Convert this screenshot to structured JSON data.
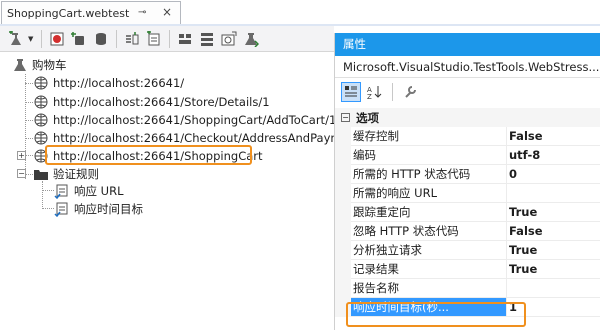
{
  "tab": {
    "title": "ShoppingCart.webtest",
    "pin_glyph": "⊸",
    "close_glyph": "×"
  },
  "toolbar": {
    "icons": [
      "add-request-icon",
      "record-icon",
      "insert-icon",
      "save-icon",
      "parameterize-icon",
      "extract-icon",
      "plugin-icon",
      "loop-icon",
      "datasource-icon",
      "credentials-icon",
      "run-icon"
    ]
  },
  "tree": {
    "root": "购物车",
    "requests": [
      "http://localhost:26641/",
      "http://localhost:26641/Store/Details/1",
      "http://localhost:26641/ShoppingCart/AddToCart/1",
      "http://localhost:26641/Checkout/AddressAndPayment",
      "http://localhost:26641/ShoppingCart"
    ],
    "validation_rules": "验证规则",
    "rules": [
      "响应 URL",
      "响应时间目标"
    ]
  },
  "properties": {
    "title": "属性",
    "object": "Microsoft.VisualStudio.TestTools.WebStress...",
    "category": "选项",
    "rows": [
      {
        "name": "缓存控制",
        "value": "False"
      },
      {
        "name": "编码",
        "value": "utf-8"
      },
      {
        "name": "所需的 HTTP 状态代码",
        "value": "0"
      },
      {
        "name": "所需的响应 URL",
        "value": ""
      },
      {
        "name": "跟踪重定向",
        "value": "True"
      },
      {
        "name": "忽略 HTTP 状态代码",
        "value": "False"
      },
      {
        "name": "分析独立请求",
        "value": "True"
      },
      {
        "name": "记录结果",
        "value": "True"
      },
      {
        "name": "报告名称",
        "value": ""
      },
      {
        "name": "响应时间目标(秒...",
        "value": "1"
      }
    ]
  },
  "colors": {
    "accent": "#1c97ea",
    "highlight": "#f0901e",
    "selection": "#3399ff"
  }
}
